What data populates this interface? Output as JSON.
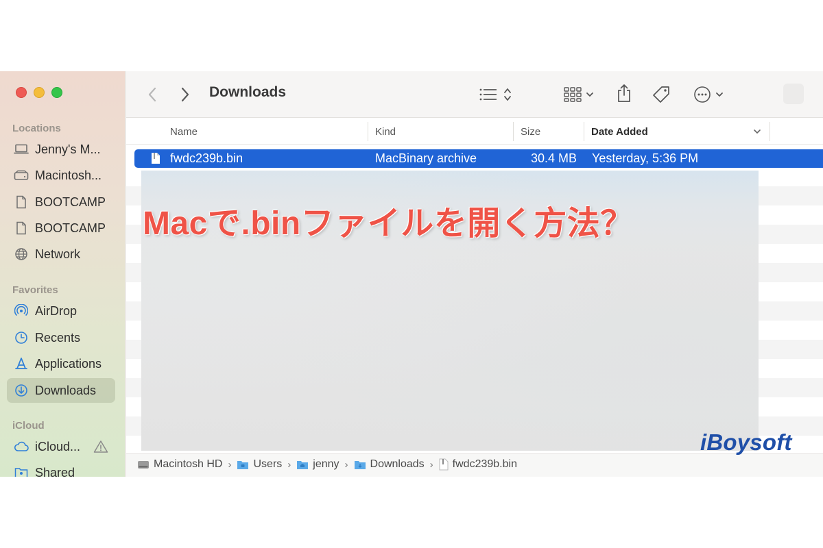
{
  "sidebar": {
    "sections": [
      {
        "label": "Locations",
        "items": [
          {
            "label": "Jenny's M...",
            "icon": "laptop-icon"
          },
          {
            "label": "Macintosh...",
            "icon": "hard-drive-icon"
          },
          {
            "label": "BOOTCAMP",
            "icon": "document-icon"
          },
          {
            "label": "BOOTCAMP",
            "icon": "document-icon"
          },
          {
            "label": "Network",
            "icon": "globe-icon"
          }
        ]
      },
      {
        "label": "Favorites",
        "items": [
          {
            "label": "AirDrop",
            "icon": "airdrop-icon"
          },
          {
            "label": "Recents",
            "icon": "clock-icon"
          },
          {
            "label": "Applications",
            "icon": "applications-icon"
          },
          {
            "label": "Downloads",
            "icon": "download-icon",
            "active": true
          }
        ]
      },
      {
        "label": "iCloud",
        "items": [
          {
            "label": "iCloud...",
            "icon": "cloud-icon"
          },
          {
            "label": "Shared",
            "icon": "shared-folder-icon"
          }
        ]
      }
    ]
  },
  "toolbar": {
    "title": "Downloads",
    "icons": [
      "back-chevron-icon",
      "forward-chevron-icon",
      "list-view-icon",
      "sort-updown-icon",
      "grid-view-icon",
      "chevron-down-icon",
      "share-icon",
      "tag-icon",
      "more-icon",
      "chevron-down-icon"
    ]
  },
  "columns": [
    {
      "label": "Name"
    },
    {
      "label": "Kind"
    },
    {
      "label": "Size"
    },
    {
      "label": "Date Added",
      "sorted": true
    }
  ],
  "files": [
    {
      "name": "fwdc239b.bin",
      "kind": "MacBinary archive",
      "size": "30.4 MB",
      "date_added": "Yesterday, 5:36 PM",
      "selected": true
    }
  ],
  "overlay": {
    "headline": "Macで.binファイルを開く方法？"
  },
  "pathbar": {
    "crumbs": [
      {
        "label": "Macintosh HD",
        "icon": "hard-drive-icon"
      },
      {
        "label": "Users",
        "icon": "folder-icon"
      },
      {
        "label": "jenny",
        "icon": "home-folder-icon"
      },
      {
        "label": "Downloads",
        "icon": "folder-icon"
      },
      {
        "label": "fwdc239b.bin",
        "icon": "file-icon"
      }
    ]
  },
  "brand": {
    "logo": "iBoysoft",
    "colors": {
      "accent": "#2064d6",
      "headline": "#ef5347",
      "logo": "#1f4fa8"
    }
  }
}
